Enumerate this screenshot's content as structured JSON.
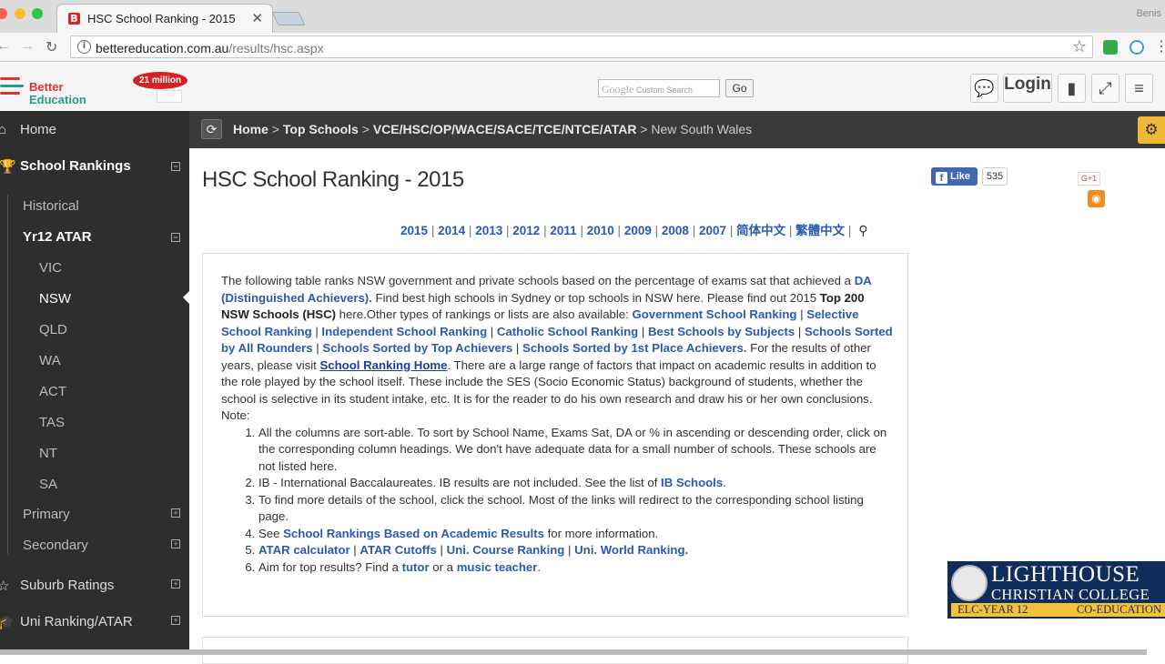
{
  "browser": {
    "tab_title": "HSC School Ranking - 2015",
    "tab_close": "✕",
    "profile_name": "Benis",
    "url_host": "bettereducation.com.au",
    "url_path": "/results/hsc.aspx"
  },
  "header": {
    "logo_line1": "Better",
    "logo_line2": "Education",
    "badge": "21 million",
    "search_google": "Google",
    "search_placeholder": "Custom Search",
    "go_label": "Go",
    "login_label": "Login"
  },
  "sidebar": {
    "home": "Home",
    "school_rankings": "School Rankings",
    "historical": "Historical",
    "yr12_atar": "Yr12 ATAR",
    "states": [
      "VIC",
      "NSW",
      "QLD",
      "WA",
      "ACT",
      "TAS",
      "NT",
      "SA"
    ],
    "primary": "Primary",
    "secondary": "Secondary",
    "suburb_ratings": "Suburb Ratings",
    "uni_ranking": "Uni Ranking/ATAR"
  },
  "breadcrumb": {
    "home": "Home",
    "top_schools": "Top Schools",
    "vce": "VCE/HSC/OP/WACE/SACE/TCE/NTCE/ATAR",
    "current": "New South Wales",
    "sep": ">"
  },
  "page": {
    "title": "HSC School Ranking - 2015",
    "fb_like": "Like",
    "fb_count": "535",
    "gplus": "G+1",
    "years": [
      "2015",
      "2014",
      "2013",
      "2012",
      "2011",
      "2010",
      "2009",
      "2008",
      "2007",
      "简体中文",
      "繁體中文"
    ],
    "year_sep": "|"
  },
  "intro": {
    "p1": "The following table ranks NSW government and private schools based on the percentage of exams sat that achieved a ",
    "da_link": "DA (Distinguished Achievers).",
    "p2": "  Find best high schools in Sydney or top schools in NSW here. Please find out 2015 ",
    "top200": "Top 200 NSW Schools (HSC)",
    "p3": " here.Other types of rankings or lists are also available: ",
    "links": [
      "Government School Ranking",
      "Selective School Ranking",
      "Independent School Ranking",
      "Catholic School Ranking",
      "Best Schools by Subjects",
      "Schools Sorted by All Rounders",
      "Schools Sorted by Top Achievers",
      "Schools Sorted by 1st Place Achievers."
    ],
    "link_sep": " | ",
    "p4": " For the results of other years, please visit ",
    "ranking_home": "School Ranking Home",
    "p5": ". There are a large range of factors that impact on academic results in addition to the role played by the school itself. These include the SES (Socio Economic Status) background of students, whether the school is selective in its student intake, etc. It is for the reader to do his own research and draw his or her own conclusions.",
    "note_label": "Note:",
    "note1": "All the columns are sort-able. To sort by School Name, Exams Sat, DA or % in ascending or descending order, click on the corresponding column headings. We don't have adequate data for a small number of schools. These schools are not listed here.",
    "note2_a": "IB - International Baccalaureates. IB results are not included. See the list of ",
    "note2_link": "IB Schools",
    "note2_b": ".",
    "note3": "To find more details of the school, click the school. Most of the links will redirect to the corresponding school listing page.",
    "note4_a": "See ",
    "note4_link": "School Rankings Based on Academic Results",
    "note4_b": " for more information.",
    "note5_links": [
      "ATAR calculator",
      "ATAR Cutoffs",
      "Uni. Course Ranking",
      "Uni. World Ranking."
    ],
    "note6_a": "Aim for top results? Find a ",
    "note6_link1": "tutor",
    "note6_b": " or a ",
    "note6_link2": "music teacher",
    "note6_c": "."
  },
  "ad": {
    "line1": "LIGHTHOUSE",
    "line2": "CHRISTIAN COLLEGE",
    "strip_left": "ELC-YEAR 12",
    "strip_right": "CO-EDUCATION"
  },
  "colors": {
    "link": "#2a5bb0",
    "sidebar_bg": "#2e2e2e",
    "crumb_bg": "#3a3a3a",
    "accent_cog": "#f0b838"
  }
}
